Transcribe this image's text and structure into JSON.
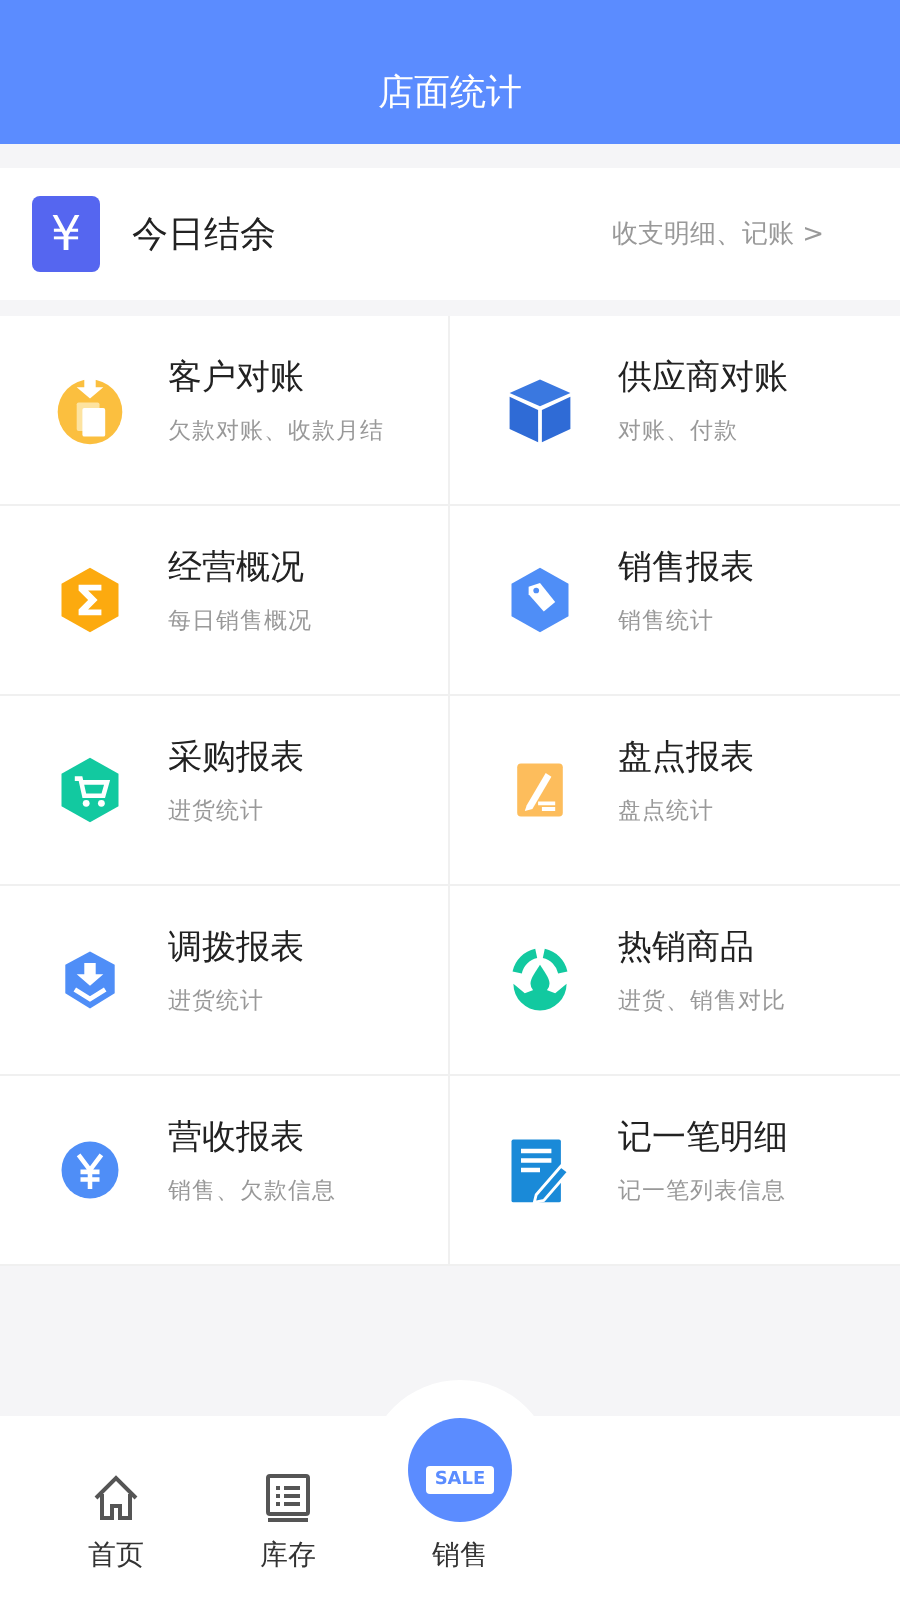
{
  "header": {
    "title": "店面统计"
  },
  "balance": {
    "icon": "¥",
    "title": "今日结余",
    "link": "收支明细、记账 >"
  },
  "grid": [
    {
      "kind": "coin",
      "title": "客户对账",
      "subtitle": "欠款对账、收款月结"
    },
    {
      "kind": "cube",
      "title": "供应商对账",
      "subtitle": "对账、付款"
    },
    {
      "kind": "sigma",
      "title": "经营概况",
      "subtitle": "每日销售概况"
    },
    {
      "kind": "tag",
      "title": "销售报表",
      "subtitle": "销售统计"
    },
    {
      "kind": "cart",
      "title": "采购报表",
      "subtitle": "进货统计"
    },
    {
      "kind": "pencil",
      "title": "盘点报表",
      "subtitle": "盘点统计"
    },
    {
      "kind": "download",
      "title": "调拨报表",
      "subtitle": "进货统计"
    },
    {
      "kind": "drop",
      "title": "热销商品",
      "subtitle": "进货、销售对比"
    },
    {
      "kind": "yen",
      "title": "营收报表",
      "subtitle": "销售、欠款信息"
    },
    {
      "kind": "note",
      "title": "记一笔明细",
      "subtitle": "记一笔列表信息"
    }
  ],
  "nav": [
    {
      "kind": "home",
      "label": "首页"
    },
    {
      "kind": "list",
      "label": "库存"
    },
    {
      "kind": "sale",
      "label": "销售",
      "badge": "SALE"
    }
  ]
}
